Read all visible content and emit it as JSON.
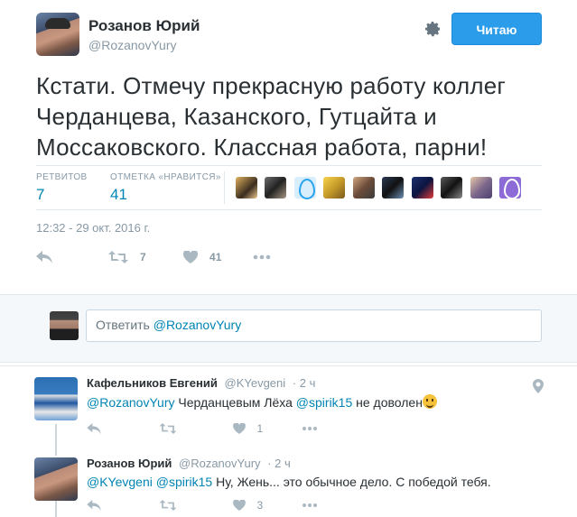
{
  "author": {
    "name": "Розанов Юрий",
    "handle": "@RozanovYury"
  },
  "follow_button": {
    "label": "Читаю"
  },
  "tweet": {
    "text": "Кстати. Отмечу прекрасную работу коллег Черданцева, Казанского, Гутцайта и Моссаковского. Классная работа, парни!",
    "timestamp": "12:32 - 29 окт. 2016 г."
  },
  "stats": {
    "retweets_label": "РЕТВИТОВ",
    "retweets": "7",
    "likes_label": "ОТМЕТКА «НРАВИТСЯ»",
    "likes": "41"
  },
  "actions": {
    "retweet_count": "7",
    "like_count": "41"
  },
  "reply_box": {
    "prefix": "Ответить",
    "mention": "@RozanovYury"
  },
  "replies": [
    {
      "name": "Кафельников Евгений",
      "handle": "@KYevgeni",
      "time": "· 2 ч",
      "mention1": "@RozanovYury",
      "text1": " Черданцевым Лёха ",
      "mention2": "@spirik15",
      "text2": "  не доволен",
      "like_count": "1"
    },
    {
      "name": "Розанов Юрий",
      "handle": "@RozanovYury",
      "time": "· 2 ч",
      "mention1": "@KYevgeni",
      "text1": " ",
      "mention2": "@spirik15",
      "text2": " Ну, Жень... это обычное дело. С победой тебя.",
      "like_count": "3"
    }
  ],
  "colors": {
    "accent": "#2b9cea",
    "link": "#0084b4",
    "muted": "#8899a6"
  }
}
